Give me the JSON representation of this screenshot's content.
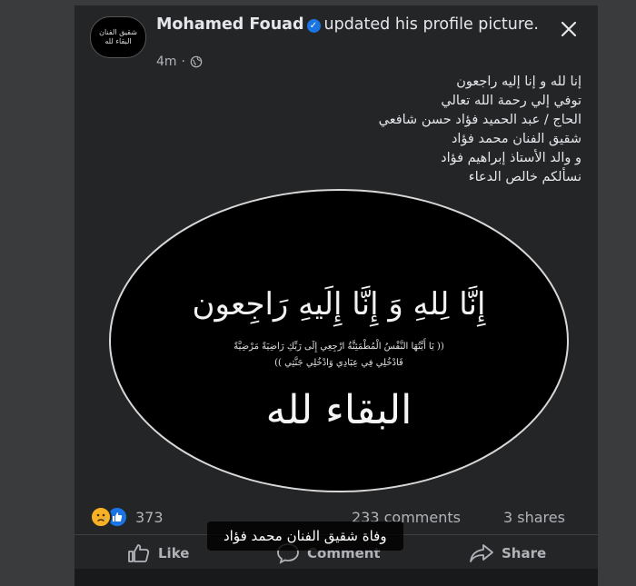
{
  "post": {
    "author": "Mohamed Fouad",
    "action_text": "updated his profile picture.",
    "time": "4m",
    "avatar_text": "شقيق الفنان\nالبقاء لله"
  },
  "caption": {
    "lines": [
      "إنا لله و إنا إليه راجعون",
      "توفي إلي رحمة الله تعالي",
      "الحاج / عبد الحميد فؤاد حسن شافعي",
      "شقيق الفنان محمد فؤاد",
      "و والد الأستاذ إبراهيم فؤاد",
      "نسألكم خالص الدعاء"
    ]
  },
  "image": {
    "verse_main": "إِنَّا لِلهِ وَ إِنَّا إِلَيهِ رَاجِعون",
    "verse_small_1": "(( يَا أَيَّتُهَا النَّفْسُ الْمُطْمَئِنَّةُ ارْجِعِي إِلَى رَبِّكِ رَاضِيَةً مَرْضِيَّةً",
    "verse_small_2": "فَادْخُلِي فِي عِبَادِي وَادْخُلِي جَنَّتِي ))",
    "baqaa": "البقاء لله"
  },
  "stats": {
    "reactions": "373",
    "comments": "233 comments",
    "shares": "3 shares"
  },
  "actions": {
    "like": "Like",
    "comment": "Comment",
    "share": "Share"
  },
  "overlay": {
    "subtitle": "وفاة شقيق الفنان محمد فؤاد"
  },
  "colors": {
    "background": "#3a3b3c",
    "card": "#242526",
    "text": "#e4e6eb",
    "secondary_text": "#b0b3b8",
    "verified_blue": "#1b74e4",
    "sad_yellow": "#f7b125"
  },
  "icons": [
    "verified-badge-icon",
    "globe-icon",
    "close-icon",
    "sad-reaction-icon",
    "like-reaction-icon",
    "like-icon",
    "comment-icon",
    "share-icon"
  ]
}
